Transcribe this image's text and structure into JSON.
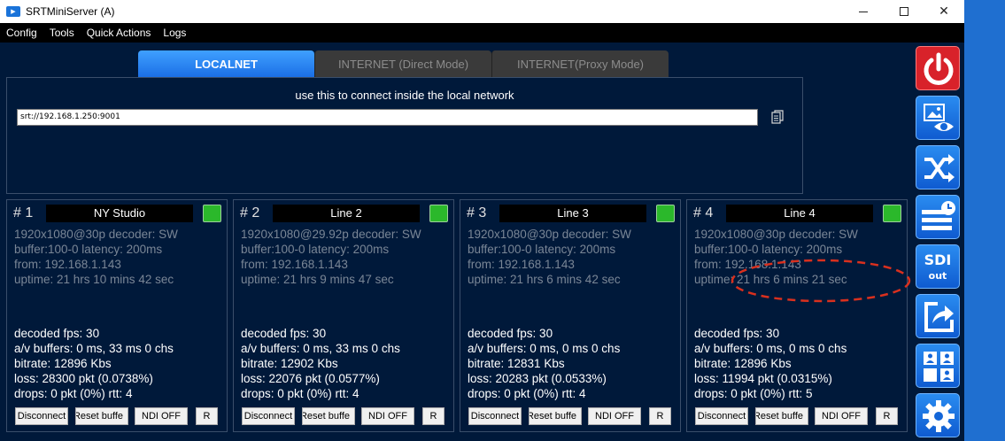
{
  "window": {
    "title": "SRTMiniServer (A)",
    "icon": "srt-app-icon"
  },
  "menu": [
    "Config",
    "Tools",
    "Quick Actions",
    "Logs"
  ],
  "tabs": [
    {
      "label": "LOCALNET",
      "active": true
    },
    {
      "label": "INTERNET (Direct Mode)",
      "active": false
    },
    {
      "label": "INTERNET(Proxy Mode)",
      "active": false
    }
  ],
  "connect": {
    "hint": "use this to connect inside the local network",
    "url": "srt://192.168.1.250:9001",
    "copy_icon": "copy-icon"
  },
  "channels": [
    {
      "num": "# 1",
      "name": "NY Studio",
      "status_color": "#2bb82b",
      "info": [
        "1920x1080@30p decoder: SW",
        "buffer:100-0 latency: 200ms",
        "from: 192.168.1.143",
        "uptime:  21 hrs 10 mins 42 sec"
      ],
      "stats": [
        "decoded fps: 30",
        "a/v buffers: 0 ms, 33 ms 0 chs",
        "bitrate: 12896 Kbs",
        "loss: 28300 pkt (0.0738%)",
        "drops: 0 pkt (0%) rtt: 4"
      ]
    },
    {
      "num": "# 2",
      "name": "Line 2",
      "status_color": "#2bb82b",
      "info": [
        "1920x1080@29.92p decoder: SW",
        "buffer:100-0 latency: 200ms",
        "from: 192.168.1.143",
        "uptime:  21 hrs 9 mins 47 sec"
      ],
      "stats": [
        "decoded fps: 30",
        "a/v buffers: 0 ms, 33 ms 0 chs",
        "bitrate: 12902 Kbs",
        "loss: 22076 pkt (0.0577%)",
        "drops: 0 pkt (0%) rtt: 4"
      ]
    },
    {
      "num": "# 3",
      "name": "Line 3",
      "status_color": "#2bb82b",
      "info": [
        "1920x1080@30p decoder: SW",
        "buffer:100-0 latency: 200ms",
        "from: 192.168.1.143",
        "uptime:  21 hrs 6 mins 42 sec"
      ],
      "stats": [
        "decoded fps: 30",
        "a/v buffers: 0 ms, 0 ms 0 chs",
        "bitrate: 12831 Kbs",
        "loss: 20283 pkt (0.0533%)",
        "drops: 0 pkt (0%) rtt: 4"
      ]
    },
    {
      "num": "# 4",
      "name": "Line 4",
      "status_color": "#2bb82b",
      "info": [
        "1920x1080@30p decoder: SW",
        "buffer:100-0 latency: 200ms",
        "from: 192.168.1.143",
        "uptime:  21 hrs 6 mins 21 sec"
      ],
      "stats": [
        "decoded fps: 30",
        "a/v buffers: 0 ms, 0 ms 0 chs",
        "bitrate: 12896 Kbs",
        "loss: 11994 pkt (0.0315%)",
        "drops: 0 pkt (0%) rtt: 5"
      ]
    }
  ],
  "channel_buttons": {
    "disconnect": "Disconnect",
    "reset": "Reset buffe",
    "ndi": "NDI OFF",
    "r": "R"
  },
  "sidebar": {
    "sdi_label": "SDI",
    "sdi_sub": "out",
    "icons": [
      "power-icon",
      "preview-icon",
      "shuffle-icon",
      "schedule-icon",
      "sdi-out-icon",
      "share-icon",
      "multiview-icon",
      "settings-icon"
    ]
  },
  "colors": {
    "background": "#00193a",
    "accent": "#1b6fe6",
    "status_ok": "#2bb82b",
    "power": "#d8222a",
    "annotation": "#d9301e"
  }
}
